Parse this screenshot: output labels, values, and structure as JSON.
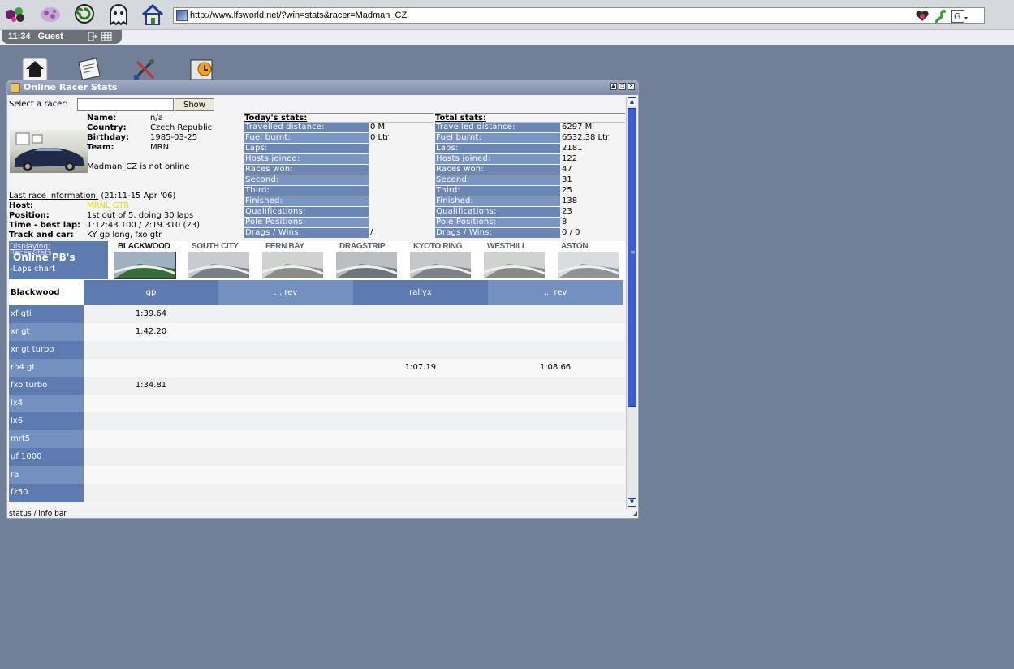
{
  "browser": {
    "url": "http://www.lfsworld.net/?win=stats&racer=Madman_CZ",
    "clock": "11:34",
    "user": "Guest",
    "toolbar_icons": [
      "dots-icon",
      "flower-icon",
      "swirl-icon",
      "ghost-icon",
      "home-icon"
    ],
    "url_right_icons": [
      "heart-plus-icon",
      "worm-icon",
      "google-icon"
    ]
  },
  "desktop_icons": [
    "home-icon",
    "newspaper-icon",
    "tools-icon",
    "clock-badge-icon"
  ],
  "window": {
    "title": "Online Racer Stats",
    "controls": [
      "▲",
      "▫",
      "✕"
    ],
    "status_bar": "status / info bar"
  },
  "select": {
    "label": "Select a racer:",
    "input_value": "",
    "button_label": "Show"
  },
  "profile": {
    "fields": [
      {
        "key": "Name:",
        "value": "n/a"
      },
      {
        "key": "Country:",
        "value": "Czech Republic"
      },
      {
        "key": "Birthday:",
        "value": "1985-03-25"
      },
      {
        "key": "Team:",
        "value": "MRNL"
      }
    ],
    "online_status": "Madman_CZ is not online",
    "last_race_link": "Last race information:",
    "last_race_time": "(21:11-15 Apr '06)",
    "last_race": [
      {
        "key": "Host:",
        "value": "MRNL GTR",
        "color": "#d9e000"
      },
      {
        "key": "Position:",
        "value": "1st out of 5, doing 30 laps"
      },
      {
        "key": "Time - best lap:",
        "value": "1:12:43.100 / 2:19.310 (23)"
      },
      {
        "key": "Track and car:",
        "value": "KY gp long, fxo gtr"
      }
    ]
  },
  "today": {
    "title": "Today's stats:",
    "rows": [
      {
        "key": "Travelled distance:",
        "value": "0 Ml"
      },
      {
        "key": "Fuel burnt:",
        "value": "0 Ltr"
      },
      {
        "key": "Laps:",
        "value": ""
      },
      {
        "key": "Hosts joined:",
        "value": ""
      },
      {
        "key": "Races won:",
        "value": ""
      },
      {
        "key": "Second:",
        "value": ""
      },
      {
        "key": "Third:",
        "value": ""
      },
      {
        "key": "Finished:",
        "value": ""
      },
      {
        "key": "Qualifications:",
        "value": ""
      },
      {
        "key": "Pole Positions:",
        "value": ""
      },
      {
        "key": "Drags / Wins:",
        "value": "/"
      }
    ]
  },
  "total": {
    "title": "Total stats:",
    "rows": [
      {
        "key": "Travelled distance:",
        "value": "6297 Ml"
      },
      {
        "key": "Fuel burnt:",
        "value": "6532.38 Ltr"
      },
      {
        "key": "Laps:",
        "value": "2181"
      },
      {
        "key": "Hosts joined:",
        "value": "122"
      },
      {
        "key": "Races won:",
        "value": "47"
      },
      {
        "key": "Second:",
        "value": "31"
      },
      {
        "key": "Third:",
        "value": "25"
      },
      {
        "key": "Finished:",
        "value": "138"
      },
      {
        "key": "Qualifications:",
        "value": "23"
      },
      {
        "key": "Pole Positions:",
        "value": "8"
      },
      {
        "key": "Drags / Wins:",
        "value": "0 / 0"
      }
    ]
  },
  "pb_panel": {
    "displaying": "Displaying:",
    "overlap_text": "Racer Stats",
    "title": "Online PB's",
    "laps_chart": "-Laps chart"
  },
  "tracks": [
    {
      "name": "BLACKWOOD",
      "active": true
    },
    {
      "name": "SOUTH CITY",
      "active": false
    },
    {
      "name": "FERN BAY",
      "active": false
    },
    {
      "name": "DRAGSTRIP",
      "active": false
    },
    {
      "name": "KYOTO RING",
      "active": false
    },
    {
      "name": "WESTHILL",
      "active": false
    },
    {
      "name": "ASTON",
      "active": false
    }
  ],
  "laps": {
    "track": "Blackwood",
    "columns": [
      "gp",
      "... rev",
      "rallyx",
      "... rev"
    ],
    "rows": [
      {
        "car": "xf gti",
        "times": [
          "1:39.64",
          "",
          "",
          ""
        ]
      },
      {
        "car": "xr gt",
        "times": [
          "1:42.20",
          "",
          "",
          ""
        ]
      },
      {
        "car": "xr gt turbo",
        "times": [
          "",
          "",
          "",
          ""
        ]
      },
      {
        "car": "rb4 gt",
        "times": [
          "",
          "",
          "1:07.19",
          "1:08.66"
        ]
      },
      {
        "car": "fxo turbo",
        "times": [
          "1:34.81",
          "",
          "",
          ""
        ]
      },
      {
        "car": "lx4",
        "times": [
          "",
          "",
          "",
          ""
        ]
      },
      {
        "car": "lx6",
        "times": [
          "",
          "",
          "",
          ""
        ]
      },
      {
        "car": "mrt5",
        "times": [
          "",
          "",
          "",
          ""
        ]
      },
      {
        "car": "uf 1000",
        "times": [
          "",
          "",
          "",
          ""
        ]
      },
      {
        "car": "ra",
        "times": [
          "",
          "",
          "",
          ""
        ]
      },
      {
        "car": "fz50",
        "times": [
          "",
          "",
          "",
          ""
        ]
      }
    ]
  },
  "colors": {
    "desktop": "#717f99",
    "header_blue": "#5d7bb0",
    "row_light": "#eef0f2",
    "scroll_blue": "#3d5bd0"
  }
}
